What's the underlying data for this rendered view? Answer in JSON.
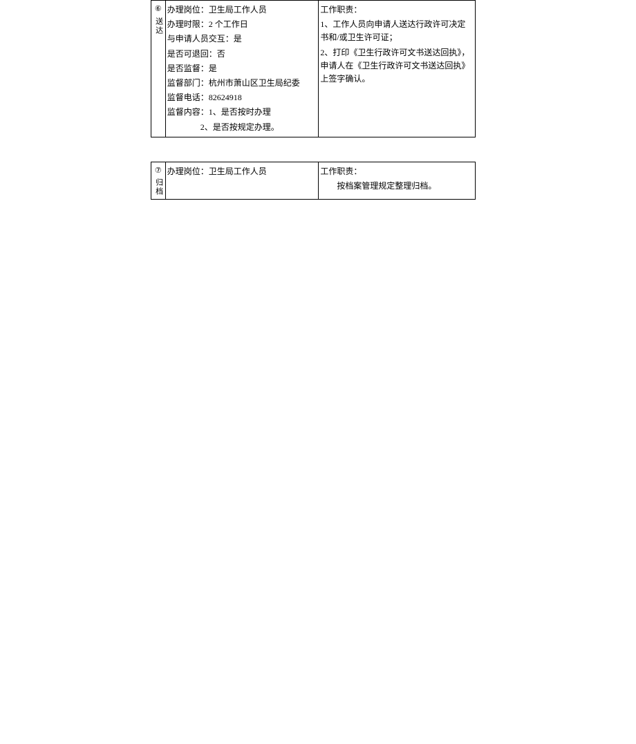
{
  "table1": {
    "step_num": "⑥",
    "step_label": "送达",
    "details": {
      "line1": "办理岗位：卫生局工作人员",
      "line2": "办理时限：2 个工作日",
      "line3": "与申请人员交互：是",
      "line4": "是否可退回：否",
      "line5": "是否监督：是",
      "line6": "监督部门：杭州市萧山区卫生局纪委",
      "line7": "监督电话：82624918",
      "line8": "监督内容：1、是否按时办理",
      "line9": "2、是否按规定办理。"
    },
    "resp": {
      "title": "工作职责：",
      "line1": "1、工作人员向申请人送达行政许可决定书和/或卫生许可证；",
      "line2": "2、打印《卫生行政许可文书送达回执》，申请人在《卫生行政许可文书送达回执》上签字确认。"
    }
  },
  "table2": {
    "step_num": "⑦",
    "step_label": "归档",
    "details": {
      "line1": "办理岗位：卫生局工作人员"
    },
    "resp": {
      "title": "工作职责：",
      "line1": "按档案管理规定整理归档。"
    }
  }
}
